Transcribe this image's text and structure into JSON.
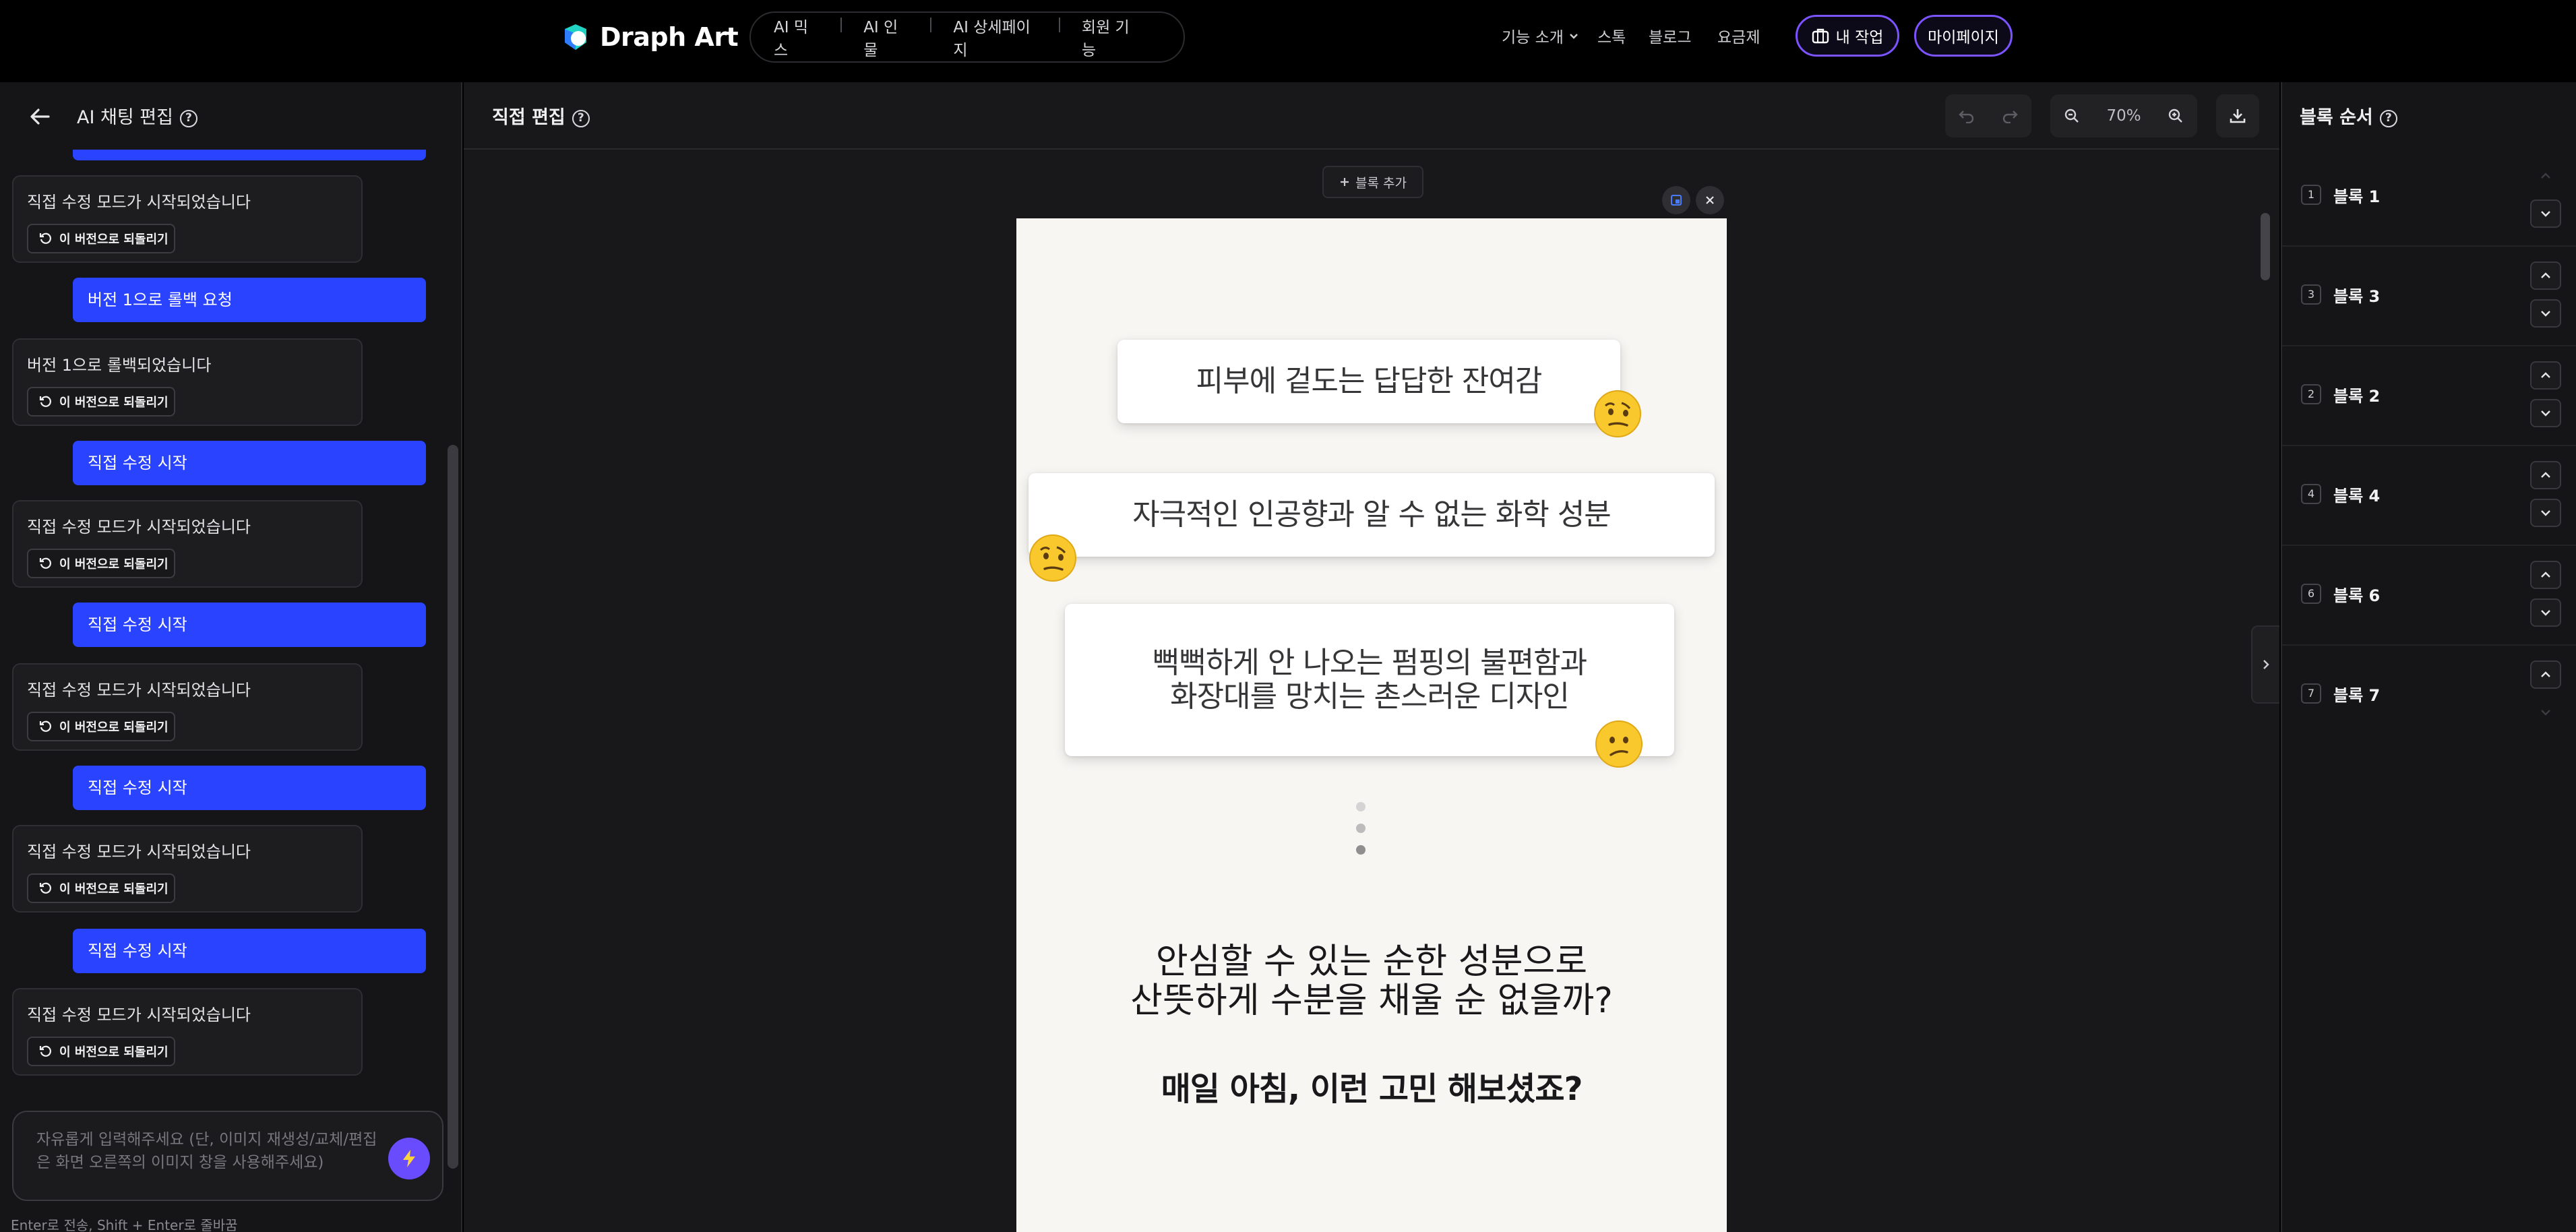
{
  "topnav": {
    "brand": "Draph Art",
    "menu": [
      "AI 믹스",
      "AI 인물",
      "AI 상세페이지",
      "회원 기능"
    ],
    "features": "기능 소개",
    "stock": "스톡",
    "blog": "블로그",
    "pricing": "요금제",
    "my_work": "내 작업",
    "mypage": "마이페이지",
    "accent": "#7b53ff"
  },
  "left_panel": {
    "title": "AI 채팅 편집",
    "revert_label": "이 버전으로 되돌리기",
    "messages": [
      {
        "role": "system",
        "text": "직접 수정 모드가 시작되었습니다"
      },
      {
        "role": "user",
        "text": "버전 1으로 롤백 요청"
      },
      {
        "role": "system",
        "text": "버전 1으로 롤백되었습니다"
      },
      {
        "role": "user",
        "text": "직접 수정 시작"
      },
      {
        "role": "system",
        "text": "직접 수정 모드가 시작되었습니다"
      },
      {
        "role": "user",
        "text": "직접 수정 시작"
      },
      {
        "role": "system",
        "text": "직접 수정 모드가 시작되었습니다"
      },
      {
        "role": "user",
        "text": "직접 수정 시작"
      },
      {
        "role": "system",
        "text": "직접 수정 모드가 시작되었습니다"
      },
      {
        "role": "user",
        "text": "직접 수정 시작"
      },
      {
        "role": "system",
        "text": "직접 수정 모드가 시작되었습니다"
      }
    ],
    "input_placeholder": "자유롭게 입력해주세요 (단, 이미지 재생성/교체/편집은 화면 오른쪽의 이미지 창을 사용해주세요)",
    "hint": "Enter로 전송, Shift + Enter로 줄바꿈",
    "user_bubble_color": "#2a43ff"
  },
  "editor": {
    "title": "직접 편집",
    "zoom": "70%",
    "add_block": "블록 추가",
    "canvas": {
      "card1": "피부에 겉도는 답답한 잔여감",
      "card2": "자극적인 인공향과 알 수 없는 화학 성분",
      "card3_line1": "뻑뻑하게 안 나오는 펌핑의 불편함과",
      "card3_line2": "화장대를 망치는 촌스러운 디자인",
      "headline_line1": "안심할 수 있는 순한 성분으로",
      "headline_line2": "산뜻하게 수분을 채울 순 없을까?",
      "subheadline": "매일 아침, 이런 고민 해보셨죠?"
    }
  },
  "block_order": {
    "title": "블록 순서",
    "blocks": [
      {
        "num": "1",
        "name": "블록 1"
      },
      {
        "num": "3",
        "name": "블록 3"
      },
      {
        "num": "2",
        "name": "블록 2"
      },
      {
        "num": "4",
        "name": "블록 4"
      },
      {
        "num": "6",
        "name": "블록 6"
      },
      {
        "num": "7",
        "name": "블록 7"
      }
    ]
  }
}
